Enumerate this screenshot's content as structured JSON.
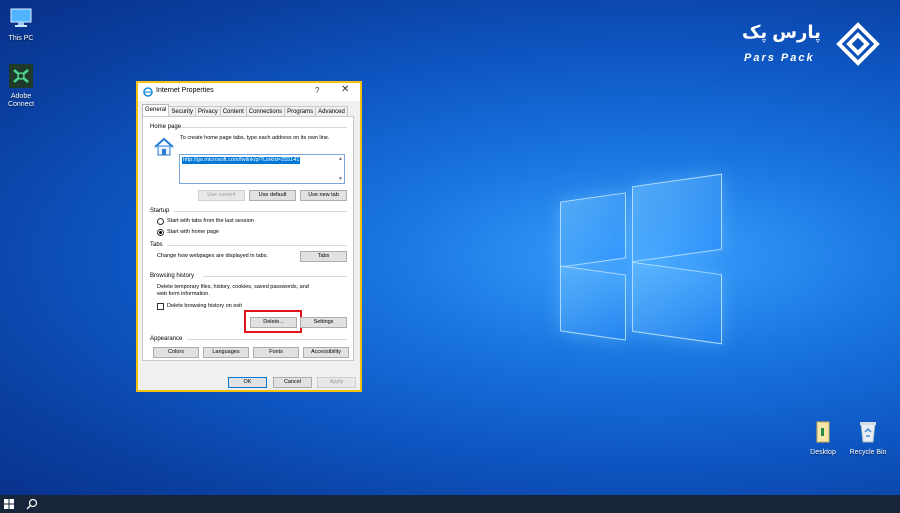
{
  "desktop": {
    "icons": [
      {
        "label": "This PC",
        "glyph": "monitor-icon"
      },
      {
        "label": "Adobe Connect",
        "glyph": "adobe-connect-icon"
      },
      {
        "label": "Desktop",
        "glyph": "folder-icon"
      },
      {
        "label": "Recycle Bin",
        "glyph": "recycle-bin-icon"
      }
    ],
    "brand": {
      "fa": "پارس پک",
      "en": "Pars Pack"
    }
  },
  "dialog": {
    "title": "Internet Properties",
    "help": "?",
    "close": "✕",
    "tabs": [
      "General",
      "Security",
      "Privacy",
      "Content",
      "Connections",
      "Programs",
      "Advanced"
    ],
    "active_tab": "General",
    "home_page": {
      "group": "Home page",
      "instructions": "To create home page tabs, type each address on its own line.",
      "url": "http://go.microsoft.com/fwlink/p/?LinkId=255141",
      "buttons": [
        "Use current",
        "Use default",
        "Use new tab"
      ]
    },
    "startup": {
      "group": "Startup",
      "options": [
        "Start with tabs from the last session",
        "Start with home page"
      ],
      "selected": 1
    },
    "tabs_group": {
      "group": "Tabs",
      "description": "Change how webpages are displayed in tabs.",
      "button": "Tabs"
    },
    "browsing_history": {
      "group": "Browsing history",
      "description_1": "Delete temporary files, history, cookies, saved passwords, and",
      "description_2": "web form information.",
      "checkbox": "Delete browsing history on exit",
      "delete_button": "Delete...",
      "settings_button": "Settings"
    },
    "appearance": {
      "group": "Appearance",
      "buttons": [
        "Colors",
        "Languages",
        "Fonts",
        "Accessibility"
      ]
    },
    "footer": {
      "ok": "OK",
      "cancel": "Cancel",
      "apply": "Apply"
    }
  },
  "colors": {
    "dialog_border": "#f4c20d",
    "highlight": "#e0151b",
    "selection": "#0078d7"
  }
}
